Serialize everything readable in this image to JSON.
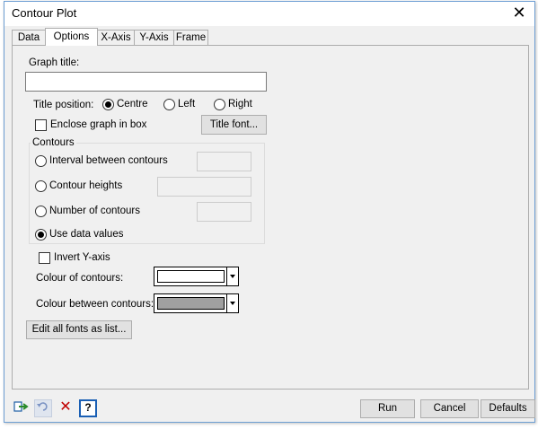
{
  "window": {
    "title": "Contour Plot"
  },
  "tabs": [
    {
      "label": "Data"
    },
    {
      "label": "Options"
    },
    {
      "label": "X-Axis"
    },
    {
      "label": "Y-Axis"
    },
    {
      "label": "Frame"
    }
  ],
  "active_tab": "Options",
  "graph_title": {
    "label": "Graph title:",
    "value": ""
  },
  "title_position": {
    "label": "Title position:",
    "options": [
      "Centre",
      "Left",
      "Right"
    ],
    "selected": "Centre"
  },
  "enclose_box": {
    "label": "Enclose graph in box",
    "checked": false
  },
  "title_font_button": "Title font...",
  "contours": {
    "group_label": "Contours",
    "options": [
      {
        "label": "Interval between contours",
        "value": ""
      },
      {
        "label": "Contour heights",
        "value": ""
      },
      {
        "label": "Number of contours",
        "value": ""
      },
      {
        "label": "Use data values"
      }
    ],
    "selected": "Use data values"
  },
  "invert_y_axis": {
    "label": "Invert Y-axis",
    "checked": false
  },
  "colour_of_contours": {
    "label": "Colour of contours:",
    "color": "#ffffff"
  },
  "colour_between_contours": {
    "label": "Colour between contours:",
    "color": "#a0a0a0"
  },
  "edit_fonts_button": "Edit all fonts as list...",
  "footer": {
    "icons": [
      "pin-icon",
      "undo-icon",
      "clear-icon",
      "help-icon"
    ],
    "run": "Run",
    "cancel": "Cancel",
    "defaults": "Defaults"
  }
}
